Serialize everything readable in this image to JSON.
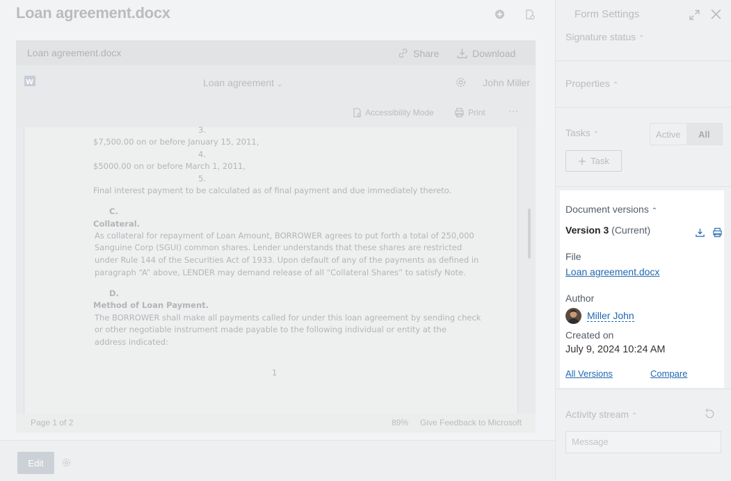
{
  "header": {
    "title": "Loan agreement.docx"
  },
  "viewer": {
    "file_name": "Loan agreement.docx",
    "share_label": "Share",
    "download_label": "Download",
    "doc_title": "Loan agreement",
    "user_name": "John Miller",
    "accessibility_label": "Accessibility Mode",
    "print_label": "Print",
    "more_label": "···",
    "page_lines": {
      "n3": "3.",
      "l1": "$7,500.00 on or before January 15, 2011,",
      "n4": "4.",
      "l2": "$5000.00  on or before March 1, 2011,",
      "n5": "5.",
      "l3": "Final interest payment to be calculated as of final payment and due immediately thereto.",
      "c": "C.",
      "collateral": "Collateral.",
      "p1": "As collateral for repayment of Loan Amount, BORROWER agrees to put forth a total of 250,000",
      "p2": "Sanguine Corp (SGUI) common shares.  Lender understands that these shares are restricted",
      "p3": "under Rule 144 of the Securities Act of 1933.  Upon default of any of the payments as defined in",
      "p4": "paragraph “A” above, LENDER may demand release of all “Collateral Shares” to satisfy Note.",
      "d": "D.",
      "method": "Method of Loan Payment.",
      "q1": "The BORROWER shall make all payments called for under this loan agreement by sending check",
      "q2": "or other negotiable instrument made payable to the following individual or entity at the",
      "q3": "address indicated:",
      "page_num": "1"
    },
    "footer": {
      "page_info": "Page 1 of 2",
      "zoom": "89%",
      "feedback": "Give Feedback to Microsoft"
    }
  },
  "bottom": {
    "edit_label": "Edit"
  },
  "sidebar": {
    "title": "Form Settings",
    "signature_status": "Signature status",
    "properties": "Properties",
    "tasks": "Tasks",
    "tasks_active": "Active",
    "tasks_all": "All",
    "task_button": "Task",
    "versions": {
      "heading": "Document versions",
      "version": "Version 3",
      "current": "(Current)",
      "file_label": "File",
      "file_link": "Loan agreement.docx",
      "author_label": "Author",
      "author_name": "Miller John",
      "created_label": "Created on",
      "created_value": "July 9, 2024 10:24 AM",
      "all_versions": "All Versions",
      "compare": "Compare"
    },
    "activity_stream": "Activity stream",
    "message_placeholder": "Message"
  },
  "colors": {
    "link": "#2067b0",
    "muted": "#b9bcbf",
    "card": "#ffffff"
  }
}
